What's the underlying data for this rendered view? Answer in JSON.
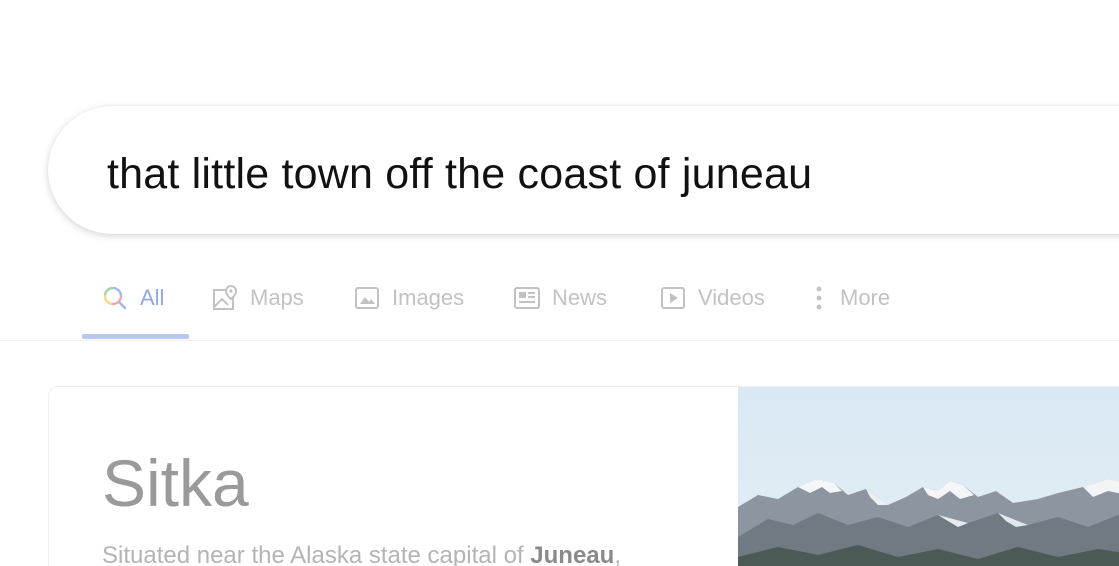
{
  "search": {
    "query": "that little town off the coast of juneau"
  },
  "tabs": [
    {
      "label": "All",
      "icon": "search-icon",
      "active": true
    },
    {
      "label": "Maps",
      "icon": "map-pin-icon"
    },
    {
      "label": "Images",
      "icon": "image-icon"
    },
    {
      "label": "News",
      "icon": "news-icon"
    },
    {
      "label": "Videos",
      "icon": "play-icon"
    },
    {
      "label": "More",
      "icon": "more-vertical-icon"
    }
  ],
  "knowledge_card": {
    "title": "Sitka",
    "description_prefix": "Situated near the Alaska state capital of ",
    "description_bold": "Juneau",
    "description_suffix": ",",
    "image": "mountains-image"
  },
  "colors": {
    "active_tab": "#8fa8e6",
    "inactive_tab": "#c2c2c2",
    "tab_underline": "#b8c8f0",
    "query_text": "#111111",
    "card_title": "#9a9a9a"
  }
}
